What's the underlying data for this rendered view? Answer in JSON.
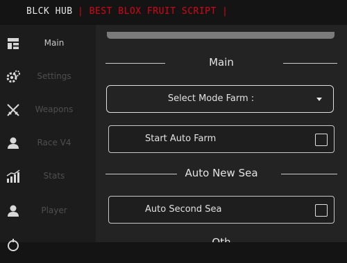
{
  "window": {
    "title": "BLCK HUB",
    "subtitle": "| BEST BLOX FRUIT SCRIPT |"
  },
  "sidebar": {
    "items": [
      {
        "label": "Main",
        "icon": "home-icon",
        "active": true
      },
      {
        "label": "Settings",
        "icon": "gear-icon",
        "active": false
      },
      {
        "label": "Weapons",
        "icon": "crossed-swords-icon",
        "active": false
      },
      {
        "label": "Race V4",
        "icon": "user-icon",
        "active": false
      },
      {
        "label": "Stats",
        "icon": "bar-chart-icon",
        "active": false
      },
      {
        "label": "Player",
        "icon": "user-icon",
        "active": false
      }
    ]
  },
  "main": {
    "sections": [
      {
        "title": "Main"
      },
      {
        "title": "Auto New Sea"
      },
      {
        "title": "Oth"
      }
    ],
    "select_mode_farm": {
      "label": "Select Mode Farm :",
      "value": ""
    },
    "toggles": [
      {
        "label": "Start Auto Farm",
        "checked": false
      },
      {
        "label": "Auto Second Sea",
        "checked": false
      }
    ]
  },
  "colors": {
    "background": "#141414",
    "sidebar": "#1c1c1c",
    "panel": "#232323",
    "accent_red": "#b3121d",
    "text": "#e4e4e4",
    "muted_text": "#4f4f4f"
  }
}
